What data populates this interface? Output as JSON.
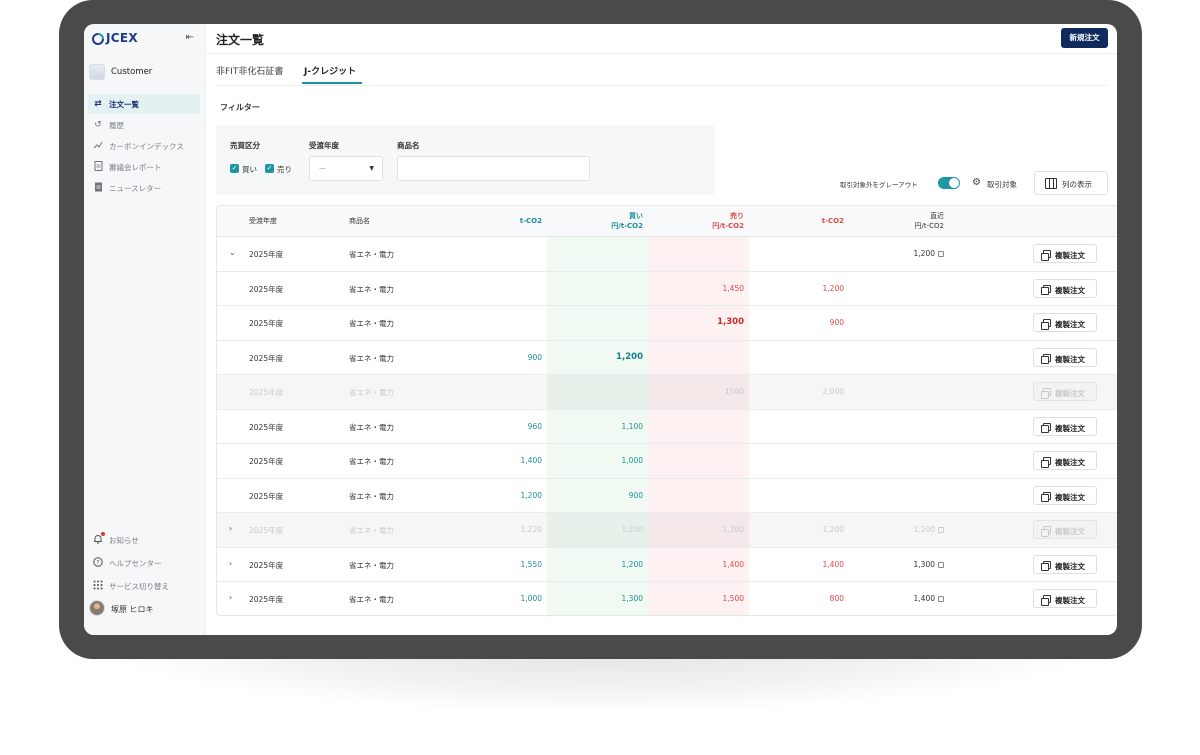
{
  "app": {
    "logo_text": "JCEX",
    "account_name": "Customer",
    "user_name": "塚原 ヒロキ"
  },
  "sidebar": {
    "items": [
      {
        "label": "注文一覧",
        "icon": "swap-arrows-icon",
        "active": true
      },
      {
        "label": "履歴",
        "icon": "history-icon",
        "active": false
      },
      {
        "label": "カーボンインデックス",
        "icon": "line-chart-icon",
        "active": false
      },
      {
        "label": "審議会レポート",
        "icon": "document-icon",
        "active": false
      },
      {
        "label": "ニュースレター",
        "icon": "newsletter-icon",
        "active": false
      }
    ],
    "bottom_items": [
      {
        "label": "お知らせ",
        "icon": "bell-icon"
      },
      {
        "label": "ヘルプセンター",
        "icon": "help-icon"
      },
      {
        "label": "サービス切り替え",
        "icon": "grid-icon"
      }
    ]
  },
  "header": {
    "title": "注文一覧",
    "new_order_label": "新規注文"
  },
  "tabs": [
    {
      "label": "非FIT非化石証書",
      "active": false
    },
    {
      "label": "J-クレジット",
      "active": true
    }
  ],
  "filter": {
    "title": "フィルター",
    "trade_type_label": "売買区分",
    "buy_label": "買い",
    "sell_label": "売り",
    "year_label": "受渡年度",
    "year_value": "—",
    "product_label": "商品名",
    "product_placeholder": ""
  },
  "controls": {
    "gray_out_label": "取引対象外をグレーアウト",
    "gray_out_on": true,
    "target_label": "取引対象",
    "columns_label": "列の表示"
  },
  "table": {
    "columns": {
      "year": "受渡年度",
      "product": "商品名",
      "buy_qty": "t-CO2",
      "buy_price_1": "買い",
      "buy_price_2": "円/t-CO2",
      "sell_price_1": "売り",
      "sell_price_2": "円/t-CO2",
      "sell_qty": "t-CO2",
      "last_1": "直近",
      "last_2": "円/t-CO2"
    },
    "copy_label": "複製注文",
    "rows": [
      {
        "chevron": "⌄",
        "year": "2025年度",
        "product": "省エネ・電力",
        "buy_qty": "",
        "buy_price": "",
        "sell_price": "",
        "sell_qty": "",
        "last": "1,200",
        "gray": false,
        "buy_bold": false,
        "sell_bold": false
      },
      {
        "chevron": "",
        "year": "2025年度",
        "product": "省エネ・電力",
        "buy_qty": "",
        "buy_price": "",
        "sell_price": "1,450",
        "sell_qty": "1,200",
        "last": "",
        "gray": false,
        "buy_bold": false,
        "sell_bold": false
      },
      {
        "chevron": "",
        "year": "2025年度",
        "product": "省エネ・電力",
        "buy_qty": "",
        "buy_price": "",
        "sell_price": "1,300",
        "sell_qty": "900",
        "last": "",
        "gray": false,
        "buy_bold": false,
        "sell_bold": true
      },
      {
        "chevron": "",
        "year": "2025年度",
        "product": "省エネ・電力",
        "buy_qty": "900",
        "buy_price": "1,200",
        "sell_price": "",
        "sell_qty": "",
        "last": "",
        "gray": false,
        "buy_bold": true,
        "sell_bold": false
      },
      {
        "chevron": "",
        "year": "2025年度",
        "product": "省エネ・電力",
        "buy_qty": "",
        "buy_price": "",
        "sell_price": "1500",
        "sell_qty": "2,000",
        "last": "",
        "gray": true,
        "buy_bold": false,
        "sell_bold": false
      },
      {
        "chevron": "",
        "year": "2025年度",
        "product": "省エネ・電力",
        "buy_qty": "960",
        "buy_price": "1,100",
        "sell_price": "",
        "sell_qty": "",
        "last": "",
        "gray": false,
        "buy_bold": false,
        "sell_bold": false
      },
      {
        "chevron": "",
        "year": "2025年度",
        "product": "省エネ・電力",
        "buy_qty": "1,400",
        "buy_price": "1,000",
        "sell_price": "",
        "sell_qty": "",
        "last": "",
        "gray": false,
        "buy_bold": false,
        "sell_bold": false
      },
      {
        "chevron": "",
        "year": "2025年度",
        "product": "省エネ・電力",
        "buy_qty": "1,200",
        "buy_price": "900",
        "sell_price": "",
        "sell_qty": "",
        "last": "",
        "gray": false,
        "buy_bold": false,
        "sell_bold": false
      },
      {
        "chevron": "›",
        "year": "2025年度",
        "product": "省エネ・電力",
        "buy_qty": "1,220",
        "buy_price": "1,200",
        "sell_price": "1,200",
        "sell_qty": "1,200",
        "last": "1,200",
        "gray": true,
        "buy_bold": false,
        "sell_bold": false
      },
      {
        "chevron": "›",
        "year": "2025年度",
        "product": "省エネ・電力",
        "buy_qty": "1,550",
        "buy_price": "1,200",
        "sell_price": "1,400",
        "sell_qty": "1,400",
        "last": "1,300",
        "gray": false,
        "buy_bold": false,
        "sell_bold": false
      },
      {
        "chevron": "›",
        "year": "2025年度",
        "product": "省エネ・電力",
        "buy_qty": "1,000",
        "buy_price": "1,300",
        "sell_price": "1,500",
        "sell_qty": "800",
        "last": "1,400",
        "gray": false,
        "buy_bold": false,
        "sell_bold": false
      }
    ]
  },
  "colors": {
    "accent_teal": "#1e97a3",
    "brand_navy": "#0f2a5c",
    "sell_red": "#e04a4a"
  }
}
